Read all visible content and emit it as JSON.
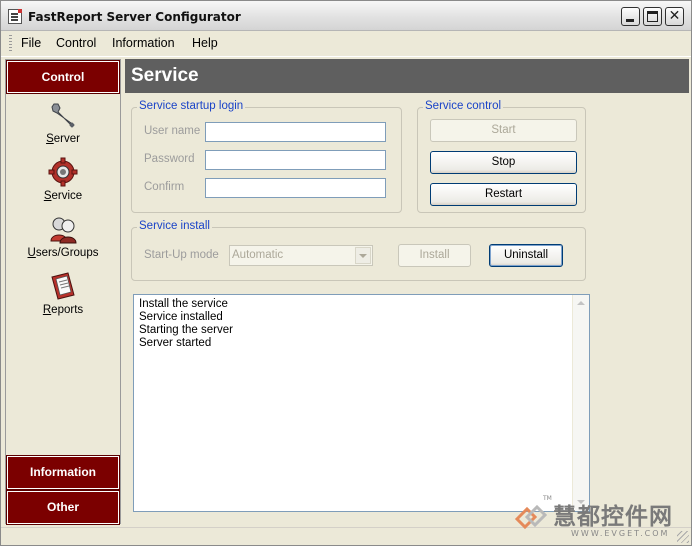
{
  "window": {
    "title": "FastReport Server Configurator"
  },
  "menu": {
    "items": [
      "File",
      "Control",
      "Information",
      "Help"
    ]
  },
  "sidebar": {
    "sections": {
      "control": "Control",
      "information": "Information",
      "other": "Other"
    },
    "items": [
      {
        "label": "Server",
        "icon": "wrench-icon"
      },
      {
        "label": "Service",
        "icon": "gear-icon"
      },
      {
        "label": "Users/Groups",
        "icon": "users-icon"
      },
      {
        "label": "Reports",
        "icon": "report-icon"
      }
    ]
  },
  "main": {
    "title": "Service",
    "login": {
      "title": "Service startup login",
      "username_label": "User name",
      "password_label": "Password",
      "confirm_label": "Confirm",
      "username_value": "",
      "password_value": "",
      "confirm_value": ""
    },
    "control": {
      "title": "Service control",
      "start": "Start",
      "stop": "Stop",
      "restart": "Restart"
    },
    "install": {
      "title": "Service install",
      "startup_label": "Start-Up mode",
      "startup_value": "Automatic",
      "install": "Install",
      "uninstall": "Uninstall"
    },
    "log": [
      "Install the service",
      "Service installed",
      "Starting the server",
      "Server started"
    ]
  },
  "watermark": {
    "text": "慧都控件网",
    "url": "WWW.EVGET.COM",
    "tm": "TM"
  },
  "colors": {
    "sidebar_header": "#7b0000",
    "page_header": "#5f5f5f",
    "group_title": "#1a43c8",
    "window_bg": "#ece9d8"
  }
}
